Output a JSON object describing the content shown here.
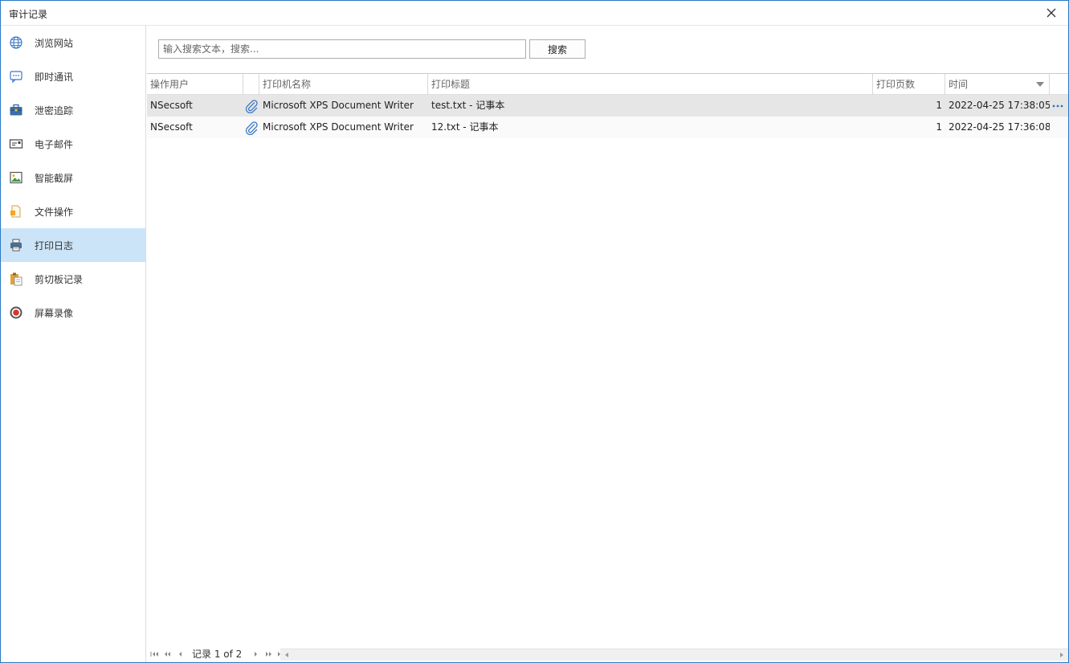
{
  "window": {
    "title": "审计记录"
  },
  "sidebar": {
    "items": [
      {
        "label": "浏览网站",
        "icon": "globe-icon"
      },
      {
        "label": "即时通讯",
        "icon": "chat-icon"
      },
      {
        "label": "泄密追踪",
        "icon": "briefcase-icon"
      },
      {
        "label": "电子邮件",
        "icon": "email-icon"
      },
      {
        "label": "智能截屏",
        "icon": "screenshot-icon"
      },
      {
        "label": "文件操作",
        "icon": "file-icon"
      },
      {
        "label": "打印日志",
        "icon": "printer-icon",
        "active": true
      },
      {
        "label": "剪切板记录",
        "icon": "clipboard-icon"
      },
      {
        "label": "屏幕录像",
        "icon": "record-icon"
      }
    ]
  },
  "search": {
    "placeholder": "输入搜索文本，搜索...",
    "value": "",
    "button_label": "搜索"
  },
  "table": {
    "columns": [
      "操作用户",
      "",
      "打印机名称",
      "打印标题",
      "打印页数",
      "时间"
    ],
    "sort_column": "时间",
    "rows": [
      {
        "user": "NSecsoft",
        "printer": "Microsoft XPS Document Writer",
        "title": "test.txt - 记事本",
        "pages": "1",
        "time": "2022-04-25 17:38:05",
        "selected": true
      },
      {
        "user": "NSecsoft",
        "printer": "Microsoft XPS Document Writer",
        "title": "12.txt - 记事本",
        "pages": "1",
        "time": "2022-04-25 17:36:08",
        "selected": false
      }
    ]
  },
  "pager": {
    "text": "记录 1 of 2"
  },
  "colors": {
    "active_nav": "#cce4f7",
    "selected_row": "#e6e6e6",
    "window_border": "#2b78c5",
    "accent": "#2b78c5"
  }
}
